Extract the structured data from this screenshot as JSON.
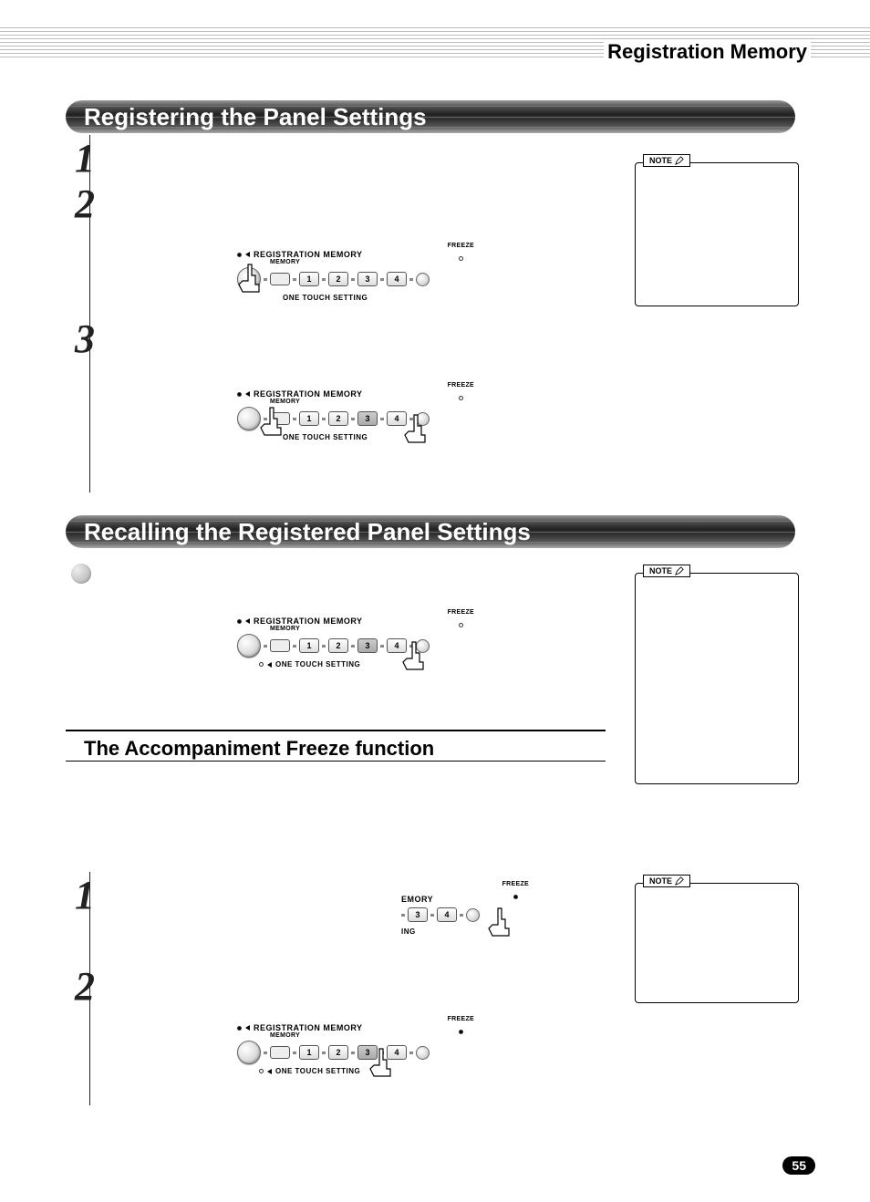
{
  "page_title": "Registration Memory",
  "page_number": "55",
  "sections": {
    "registering": {
      "title": "Registering the Panel Settings",
      "steps": [
        "1",
        "2",
        "3"
      ]
    },
    "recalling": {
      "title": "Recalling the Registered Panel Settings"
    },
    "freeze": {
      "title": "The Accompaniment Freeze function",
      "steps": [
        "1",
        "2"
      ]
    }
  },
  "note_label": "NOTE",
  "panel": {
    "title": "REGISTRATION MEMORY",
    "memory_label": "MEMORY",
    "ots_label": "ONE TOUCH SETTING",
    "freeze_label": "FREEZE",
    "buttons": [
      "1",
      "2",
      "3",
      "4"
    ],
    "partial_title": "EMORY",
    "partial_ots": "ING"
  }
}
